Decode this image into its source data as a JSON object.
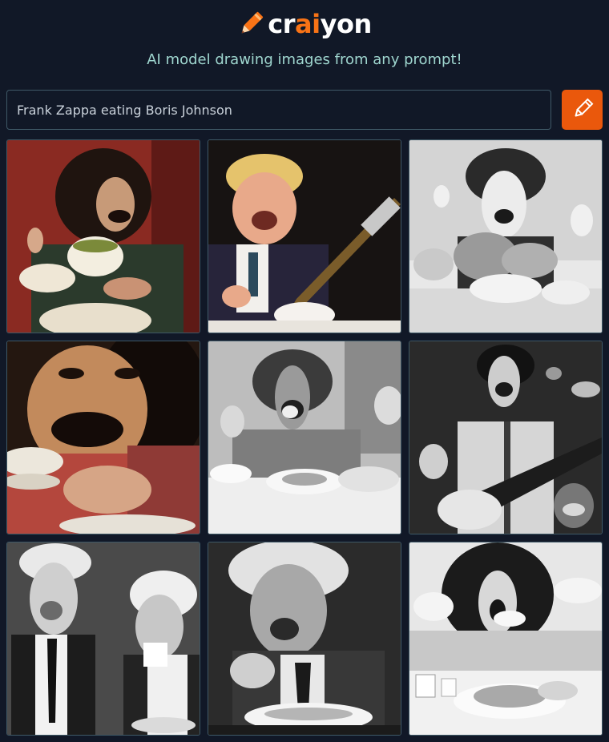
{
  "brand": {
    "name_prefix": "cr",
    "name_accent": "ai",
    "name_suffix": "yon",
    "accent_color": "#f97316",
    "logo_icon": "pencil-icon"
  },
  "tagline": "AI model drawing images from any prompt!",
  "prompt": {
    "value": "Frank Zappa eating Boris Johnson",
    "button_icon": "pencil-icon",
    "button_color": "#ea580c"
  },
  "results": [
    {
      "id": "result-1"
    },
    {
      "id": "result-2"
    },
    {
      "id": "result-3"
    },
    {
      "id": "result-4"
    },
    {
      "id": "result-5"
    },
    {
      "id": "result-6"
    },
    {
      "id": "result-7"
    },
    {
      "id": "result-8"
    },
    {
      "id": "result-9"
    }
  ]
}
